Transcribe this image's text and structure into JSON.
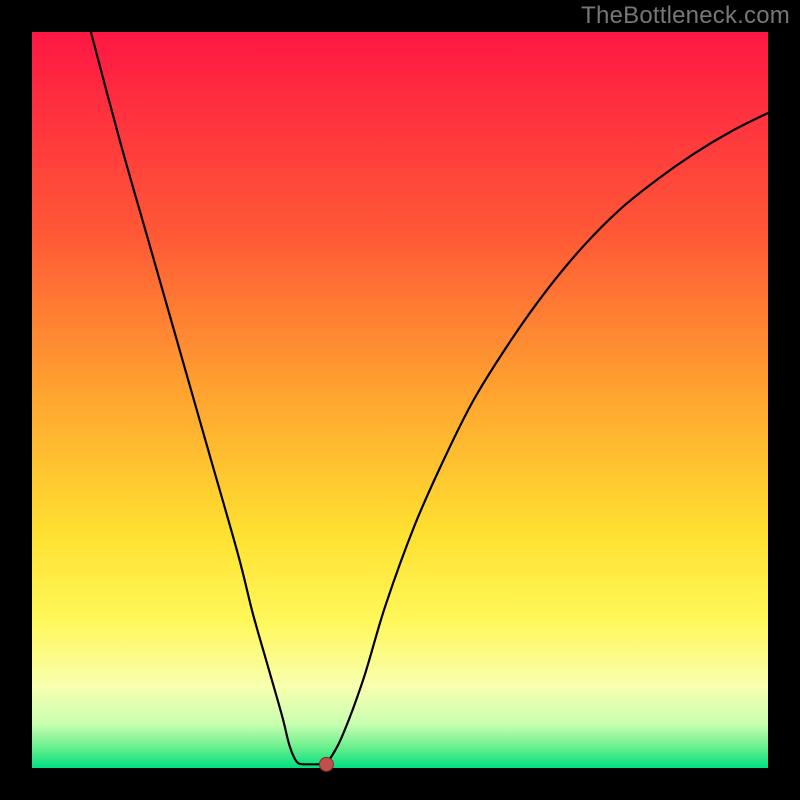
{
  "watermark": "TheBottleneck.com",
  "colors": {
    "frame": "#000000",
    "curve": "#000000",
    "marker_fill": "#c05050",
    "marker_stroke": "#803020",
    "gradient_stops": [
      {
        "offset": 0.0,
        "color": "#ff1744"
      },
      {
        "offset": 0.28,
        "color": "#ff5a36"
      },
      {
        "offset": 0.48,
        "color": "#ffa030"
      },
      {
        "offset": 0.68,
        "color": "#ffe030"
      },
      {
        "offset": 0.8,
        "color": "#fff85a"
      },
      {
        "offset": 0.89,
        "color": "#f8ffb0"
      },
      {
        "offset": 0.94,
        "color": "#c8ffb0"
      },
      {
        "offset": 0.97,
        "color": "#70f090"
      },
      {
        "offset": 1.0,
        "color": "#00e080"
      }
    ]
  },
  "chart_data": {
    "type": "line",
    "title": "",
    "xlabel": "",
    "ylabel": "",
    "xlim": [
      0,
      100
    ],
    "ylim": [
      0,
      100
    ],
    "left_branch": {
      "points": [
        {
          "x": 8,
          "y": 100
        },
        {
          "x": 12,
          "y": 85
        },
        {
          "x": 16,
          "y": 71
        },
        {
          "x": 20,
          "y": 57
        },
        {
          "x": 24,
          "y": 43
        },
        {
          "x": 28,
          "y": 29
        },
        {
          "x": 30,
          "y": 21
        },
        {
          "x": 32,
          "y": 14
        },
        {
          "x": 34,
          "y": 7
        },
        {
          "x": 35,
          "y": 3
        },
        {
          "x": 36,
          "y": 0.8
        },
        {
          "x": 37,
          "y": 0.5
        }
      ]
    },
    "flat_segment": {
      "points": [
        {
          "x": 37,
          "y": 0.5
        },
        {
          "x": 40,
          "y": 0.5
        }
      ]
    },
    "right_branch": {
      "points": [
        {
          "x": 40,
          "y": 0.5
        },
        {
          "x": 42,
          "y": 4
        },
        {
          "x": 45,
          "y": 12
        },
        {
          "x": 48,
          "y": 22
        },
        {
          "x": 52,
          "y": 33
        },
        {
          "x": 56,
          "y": 42
        },
        {
          "x": 60,
          "y": 50
        },
        {
          "x": 65,
          "y": 58
        },
        {
          "x": 70,
          "y": 65
        },
        {
          "x": 75,
          "y": 71
        },
        {
          "x": 80,
          "y": 76
        },
        {
          "x": 85,
          "y": 80
        },
        {
          "x": 90,
          "y": 83.5
        },
        {
          "x": 95,
          "y": 86.5
        },
        {
          "x": 100,
          "y": 89
        }
      ]
    },
    "marker": {
      "x": 40,
      "y": 0.5
    }
  }
}
